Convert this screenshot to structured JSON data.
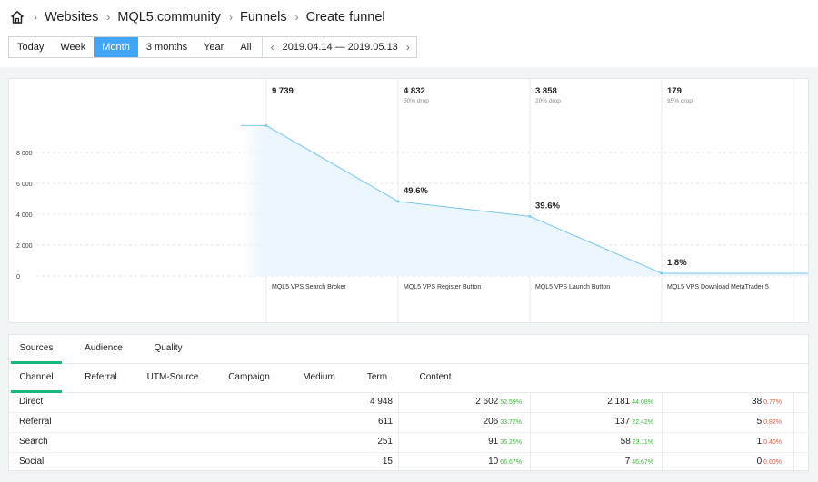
{
  "breadcrumb": {
    "items": [
      "Websites",
      "MQL5.community",
      "Funnels",
      "Create funnel"
    ]
  },
  "period": {
    "buttons": [
      "Today",
      "Week",
      "Month",
      "3 months",
      "Year",
      "All"
    ],
    "active": "Month",
    "range": "2019.04.14 — 2019.05.13"
  },
  "chart_data": {
    "type": "area",
    "yticks": [
      "8 000",
      "6 000",
      "4 000",
      "2 000",
      "0"
    ],
    "steps": [
      {
        "total": "9 739",
        "drop": "",
        "conversion": "",
        "label": "MQL5 VPS Search Broker",
        "value": 9739
      },
      {
        "total": "4 832",
        "drop": "50% drop",
        "conversion": "49.6%",
        "label": "MQL5 VPS Register Button",
        "value": 4832
      },
      {
        "total": "3 858",
        "drop": "20% drop",
        "conversion": "39.6%",
        "label": "MQL5 VPS Launch Button",
        "value": 3858
      },
      {
        "total": "179",
        "drop": "95% drop",
        "conversion": "1.8%",
        "label": "MQL5 VPS Download MetaTrader 5",
        "value": 179
      }
    ],
    "line_color": "#7ec8ea",
    "fill_color": "#eaf5fc"
  },
  "tabs": [
    "Sources",
    "Audience",
    "Quality"
  ],
  "subtabs": [
    "Channel",
    "Referral",
    "UTM-Source",
    "Campaign",
    "Medium",
    "Term",
    "Content"
  ],
  "table": {
    "rows": [
      {
        "name": "Direct",
        "total": "4 948",
        "s1": "2 602",
        "p1": "52.59%",
        "s2": "2 181",
        "p2": "44.08%",
        "s3": "38",
        "p3": "0.77%"
      },
      {
        "name": "Referral",
        "total": "611",
        "s1": "206",
        "p1": "33.72%",
        "s2": "137",
        "p2": "22.42%",
        "s3": "5",
        "p3": "0.82%"
      },
      {
        "name": "Search",
        "total": "251",
        "s1": "91",
        "p1": "36.25%",
        "s2": "58",
        "p2": "23.11%",
        "s3": "1",
        "p3": "0.40%"
      },
      {
        "name": "Social",
        "total": "15",
        "s1": "10",
        "p1": "66.67%",
        "s2": "7",
        "p2": "46.67%",
        "s3": "0",
        "p3": "0.00%"
      }
    ]
  },
  "colors": {
    "accent": "#42a5f5",
    "tab_active": "#19b77c",
    "pct_good": "#3db33d",
    "pct_bad": "#e9573f"
  }
}
